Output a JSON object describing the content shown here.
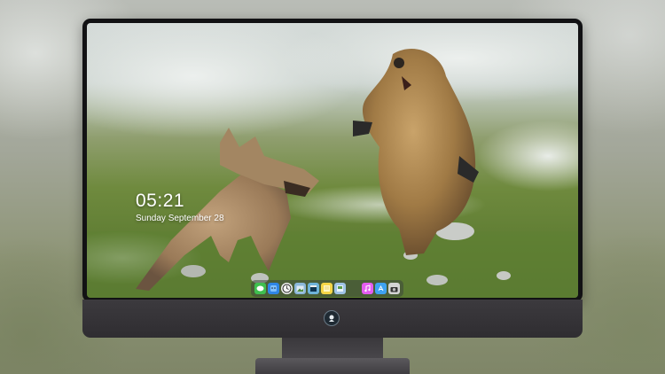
{
  "lock_screen": {
    "time": "05:21",
    "date": "Sunday September  28"
  },
  "dock": {
    "apps": [
      {
        "icon": "messages-icon",
        "color": "#3fbf4f"
      },
      {
        "icon": "finder-icon",
        "color": "#2f86e6"
      },
      {
        "icon": "clock-icon",
        "color": "#f2f2f2"
      },
      {
        "icon": "photo-icon",
        "color": "#8bb7d9"
      },
      {
        "icon": "clapper-icon",
        "color": "#6fb3d9"
      },
      {
        "icon": "notes-icon",
        "color": "#f5d547"
      },
      {
        "icon": "preview-icon",
        "color": "#9fc3e6"
      },
      {
        "icon": "music-icon",
        "color": "#e45cf0"
      },
      {
        "icon": "appstore-icon",
        "color": "#3ea2f2"
      },
      {
        "icon": "camera-icon",
        "color": "#d4d4d4"
      }
    ]
  },
  "colors": {
    "bezel": "#121214",
    "chin": "#2f2d31",
    "stand": "#4a484c"
  }
}
